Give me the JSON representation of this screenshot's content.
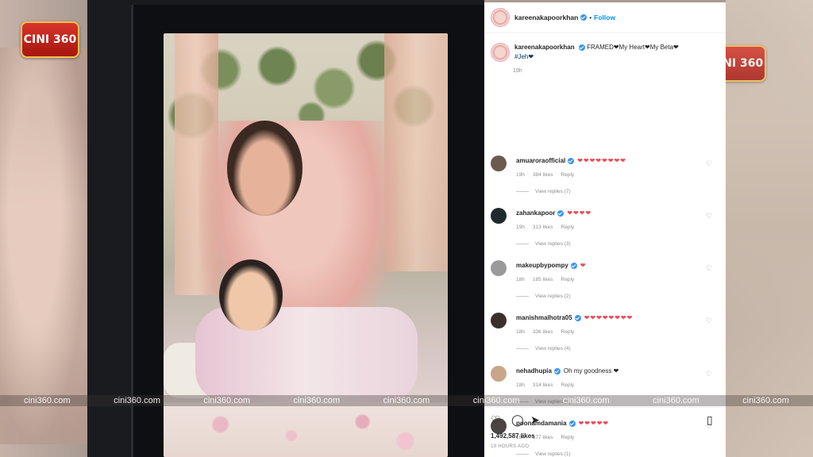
{
  "brand": {
    "logo_text": "CINI 360",
    "watermark": "cini360.com"
  },
  "post": {
    "username": "kareenakapoorkhan",
    "follow_label": "Follow",
    "caption": "FRAMED❤My Heart❤My Beta❤",
    "hashtag": "#Jeh❤",
    "caption_time": "19h",
    "likes": "1,492,587 likes",
    "posted_ago": "19 HOURS AGO"
  },
  "comments": [
    {
      "user": "amuaroraofficial",
      "text": "❤❤❤❤❤❤❤❤",
      "text_is_hearts": true,
      "time": "19h",
      "likes": "384 likes",
      "reply": "Reply",
      "replies": "View replies (7)",
      "avatar_color": "#6b5a4e"
    },
    {
      "user": "zahankapoor",
      "text": "❤❤❤❤",
      "text_is_hearts": true,
      "time": "19h",
      "likes": "313 likes",
      "reply": "Reply",
      "replies": "View replies (3)",
      "avatar_color": "#1f2a2e"
    },
    {
      "user": "makeupbypompy",
      "text": "❤",
      "text_is_hearts": true,
      "time": "18h",
      "likes": "185 likes",
      "reply": "Reply",
      "replies": "View replies (2)",
      "avatar_color": "#9a9a9a"
    },
    {
      "user": "manishmalhotra05",
      "text": "❤❤❤❤❤❤❤❤",
      "text_is_hearts": true,
      "time": "18h",
      "likes": "336 likes",
      "reply": "Reply",
      "replies": "View replies (4)",
      "avatar_color": "#3b2f2b"
    },
    {
      "user": "nehadhupia",
      "text": "Oh my goodness ❤",
      "text_is_hearts": false,
      "time": "18h",
      "likes": "314 likes",
      "reply": "Reply",
      "replies": "View replies (4)",
      "avatar_color": "#c9a58a"
    },
    {
      "user": "poonamdamania",
      "text": "❤❤❤❤❤",
      "text_is_hearts": true,
      "time": "18h",
      "likes": "177 likes",
      "reply": "Reply",
      "replies": "View replies (1)",
      "avatar_color": "#4a4442"
    }
  ],
  "icons": {
    "like": "heart-outline-icon",
    "comment": "comment-icon",
    "share": "share-icon",
    "save": "bookmark-icon",
    "comment_like": "heart-outline-icon"
  },
  "colors": {
    "accent": "#0095f6",
    "heart": "#ed4956",
    "verified": "#3897f0"
  }
}
